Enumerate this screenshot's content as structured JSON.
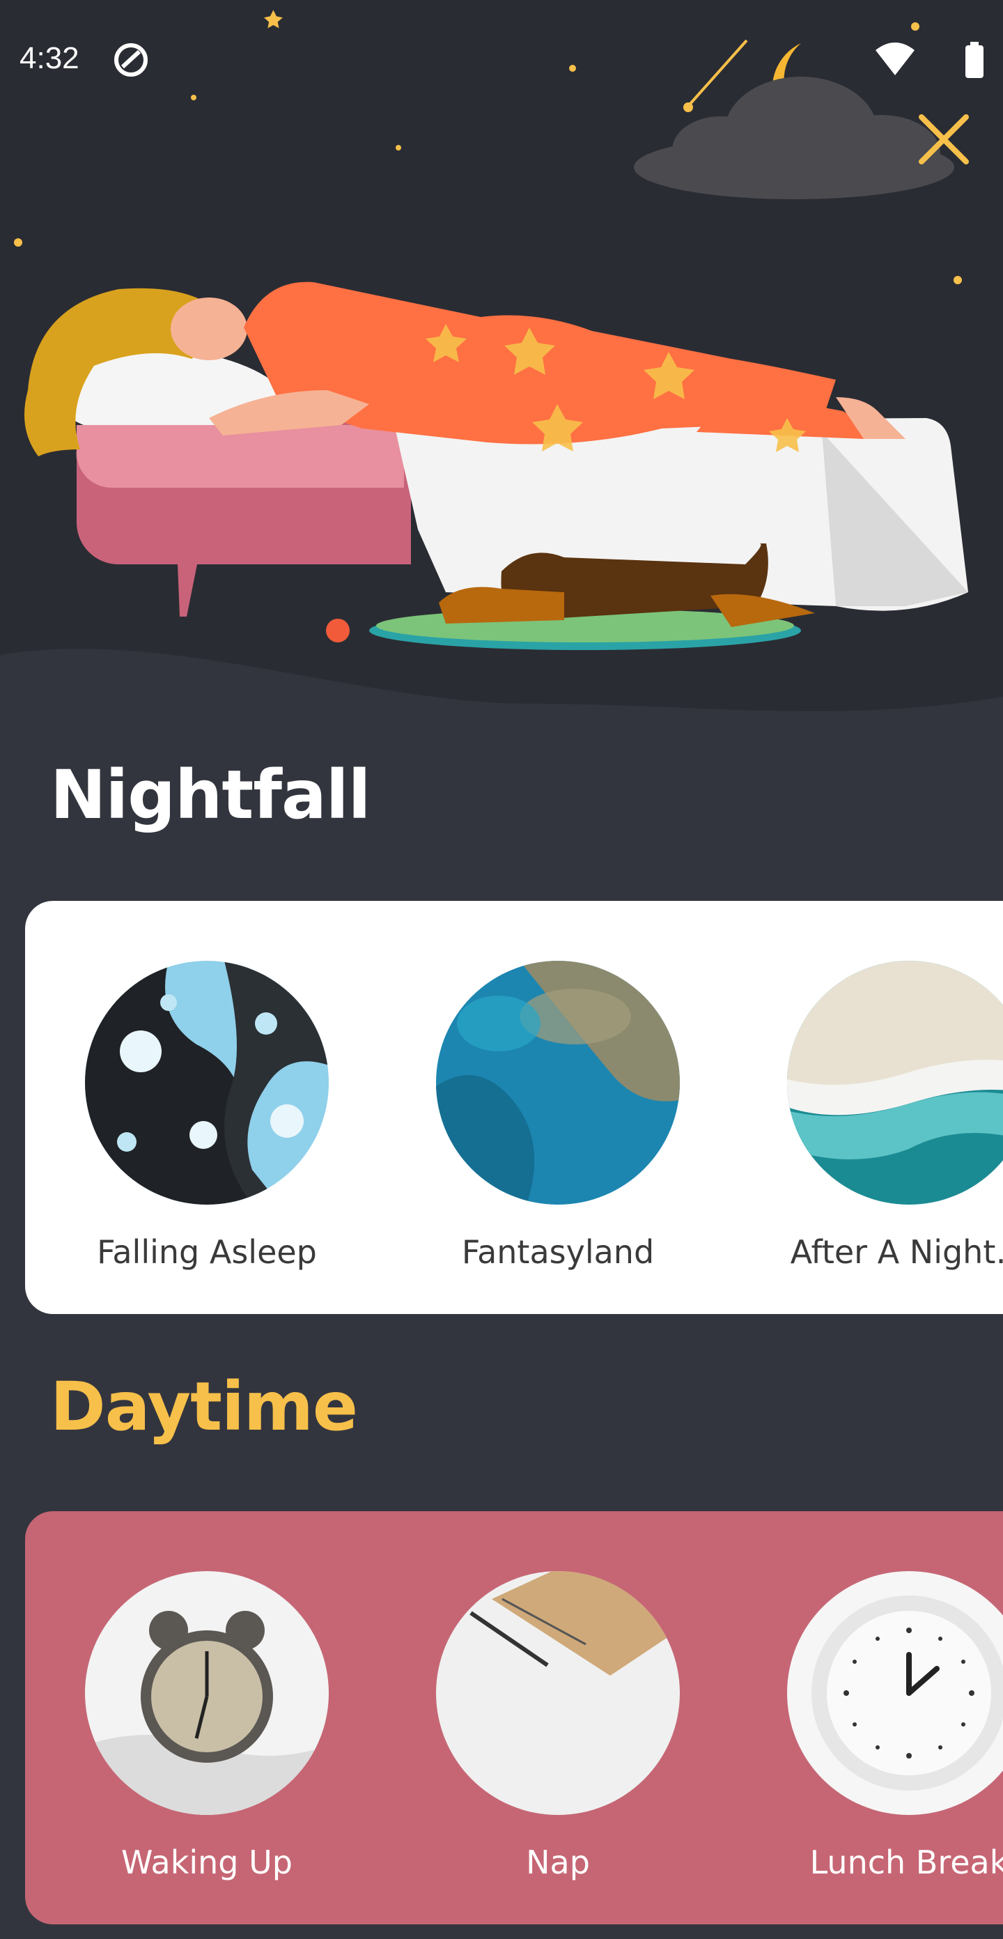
{
  "status_bar": {
    "time": "4:32",
    "icons": [
      "sync-icon",
      "wifi-icon",
      "battery-icon"
    ]
  },
  "header": {
    "close_icon": "close-icon",
    "illustration": "sleeping-woman-illustration"
  },
  "sections": [
    {
      "title": "Nightfall",
      "title_color": "#ffffff",
      "card_color": "#ffffff",
      "items": [
        {
          "label": "Falling Asleep",
          "image": "marble-blue-art"
        },
        {
          "label": "Fantasyland",
          "image": "ocean-reef-aerial"
        },
        {
          "label": "After A Night…",
          "image": "beach-waves-aerial"
        }
      ]
    },
    {
      "title": "Daytime",
      "title_color": "#f7c04a",
      "card_color": "#c66674",
      "items": [
        {
          "label": "Waking Up",
          "image": "alarm-clock"
        },
        {
          "label": "Nap",
          "image": "notebook-pen"
        },
        {
          "label": "Lunch Break",
          "image": "lunch-time-clock"
        }
      ]
    }
  ],
  "colors": {
    "background": "#33353e",
    "hero_background": "#2a2c33",
    "accent": "#f7c04a"
  }
}
